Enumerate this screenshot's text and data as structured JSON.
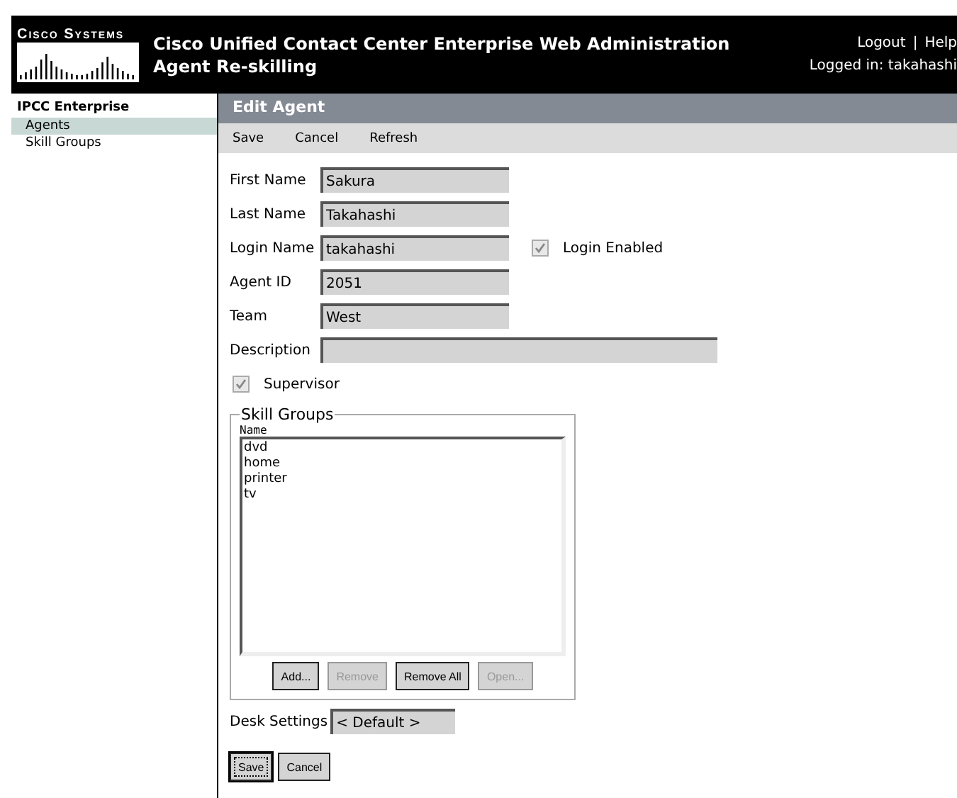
{
  "header": {
    "logo_text": "Cisco Systems",
    "title": "Cisco Unified Contact Center Enterprise Web Administration",
    "subtitle": "Agent Re-skilling",
    "links": [
      "Logout",
      "Help"
    ],
    "separator": "|",
    "logged_in": "Logged in: takahashi"
  },
  "sidebar": {
    "heading": "IPCC Enterprise",
    "items": [
      {
        "label": "Agents",
        "selected": true
      },
      {
        "label": "Skill Groups",
        "selected": false
      }
    ]
  },
  "panel": {
    "title": "Edit Agent",
    "toolbar": [
      "Save",
      "Cancel",
      "Refresh"
    ]
  },
  "fields": [
    {
      "label": "First Name",
      "value": "Sakura",
      "wide": false
    },
    {
      "label": "Last Name",
      "value": "Takahashi",
      "wide": false
    },
    {
      "label": "Login Name",
      "value": "takahashi",
      "wide": false,
      "checkbox": {
        "label": "Login Enabled",
        "checked": true
      }
    },
    {
      "label": "Agent ID",
      "value": "2051",
      "wide": false
    },
    {
      "label": "Team",
      "value": "West",
      "wide": false
    },
    {
      "label": "Description",
      "wide": true
    }
  ],
  "supervisor": {
    "label": "Supervisor",
    "checked": true
  },
  "skill_groups": {
    "legend": "Skill Groups",
    "column": "Name",
    "items": [
      "dvd",
      "home",
      "printer",
      "tv"
    ],
    "buttons": [
      {
        "label": "Add...",
        "disabled": false
      },
      {
        "label": "Remove",
        "disabled": true
      },
      {
        "label": "Remove All",
        "disabled": false
      },
      {
        "label": "Open...",
        "disabled": true
      }
    ]
  },
  "desk_settings": {
    "label": "Desk Settings",
    "value": "< Default >"
  },
  "buttons": [
    {
      "label": "Save",
      "default": true
    },
    {
      "label": "Cancel",
      "default": false
    }
  ]
}
